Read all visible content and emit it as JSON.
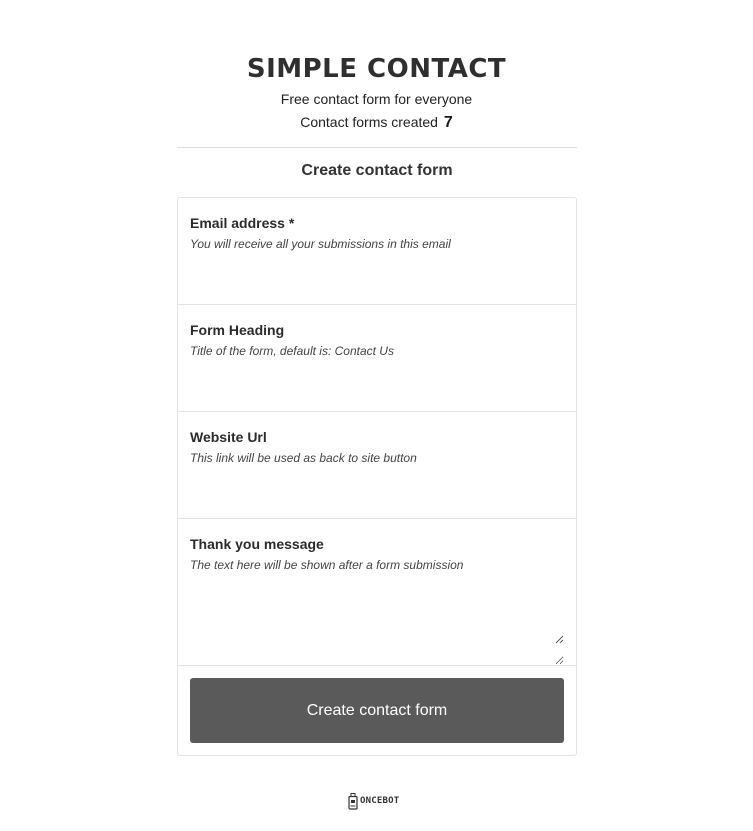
{
  "header": {
    "title": "SIMPLE CONTACT",
    "tagline": "Free contact form for everyone",
    "counter_label": "Contact forms created",
    "counter_value": "7"
  },
  "form": {
    "section_title": "Create contact form",
    "fields": [
      {
        "label": "Email address *",
        "hint": "You will receive all your submissions in this email",
        "value": ""
      },
      {
        "label": "Form Heading",
        "hint": "Title of the form, default is: Contact Us",
        "value": ""
      },
      {
        "label": "Website Url",
        "hint": "This link will be used as back to site button",
        "value": ""
      },
      {
        "label": "Thank you message",
        "hint": "The text here will be shown after a form submission",
        "value": ""
      }
    ],
    "submit_label": "Create contact form"
  },
  "footer": {
    "brand": "ONCEBOT",
    "logo_icon": "robot-bottle-icon"
  },
  "colors": {
    "button_bg": "#5a5a5a",
    "border": "#e4e4e4",
    "text": "#333333"
  }
}
